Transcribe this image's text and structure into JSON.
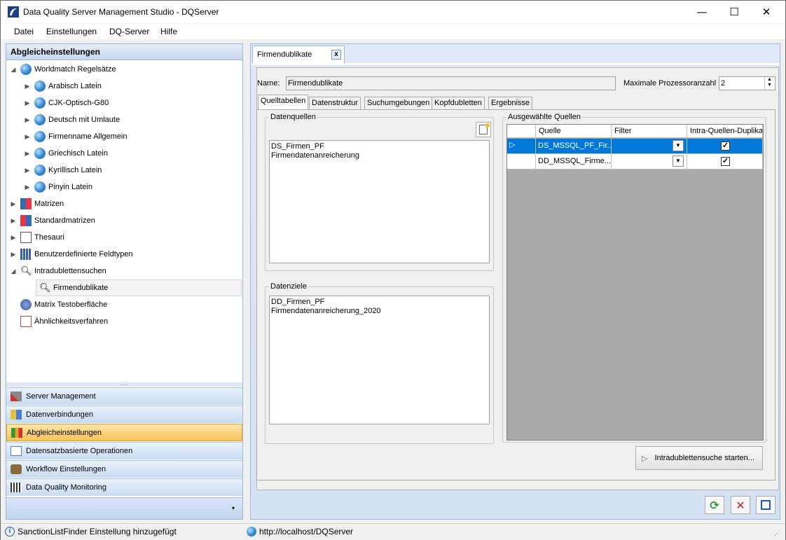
{
  "window": {
    "title": "Data Quality Server Management Studio - DQServer",
    "minimize": "—",
    "maximize": "☐",
    "close": "✕"
  },
  "menu": [
    "Datei",
    "Einstellungen",
    "DQ-Server",
    "Hilfe"
  ],
  "left_panel": {
    "header": "Abgleicheinstellungen",
    "tree": {
      "worldmatch": "Worldmatch Regelsätze",
      "children": [
        "Arabisch Latein",
        "CJK-Optisch-G80",
        "Deutsch mit Umlaute",
        "Firmenname Allgemein",
        "Griechisch Latein",
        "Kyrillisch Latein",
        "Pinyin Latein"
      ],
      "matrizen": "Matrizen",
      "standardmatrizen": "Standardmatrizen",
      "thesauri": "Thesauri",
      "feldtypen": "Benutzerdefinierte Feldtypen",
      "intradubletten": "Intradublettensuchen",
      "firmendublikate": "Firmendublikate",
      "matrix_test": "Matrix Testoberfläche",
      "aehnlichkeit": "Ähnlichkeitsverfahren"
    },
    "nav": [
      "Server Management",
      "Datenverbindungen",
      "Abgleicheinstellungen",
      "Datensatzbasierte Operationen",
      "Workflow Einstellungen",
      "Data Quality Monitoring"
    ]
  },
  "document": {
    "tab_label": "Firmendublikate",
    "tab_close": "x",
    "name_label": "Name:",
    "name_value": "Firmendublikate",
    "max_proc_label": "Maximale Prozessoranzahl",
    "max_proc_value": "2",
    "tabs": [
      "Quelltabellen",
      "Datenstruktur",
      "Suchumgebungen",
      "Kopfdubletten",
      "Ergebnisse"
    ],
    "datenquellen": {
      "title": "Datenquellen",
      "items": [
        "DS_Firmen_PF",
        "Firmendatenanreicherung"
      ]
    },
    "datenziele": {
      "title": "Datenziele",
      "items": [
        "DD_Firmen_PF",
        "Firmendatenanreicherung_2020"
      ]
    },
    "ausgewaehlte": {
      "title": "Ausgewählte Quellen",
      "columns": [
        "Quelle",
        "Filter",
        "Intra-Quellen-Duplikate"
      ],
      "rows": [
        {
          "quelle": "DS_MSSQL_PF_Fir...",
          "checked": true
        },
        {
          "quelle": "DD_MSSQL_Firme...",
          "checked": true
        }
      ]
    },
    "start_button": "Intradublettensuche starten..."
  },
  "status": {
    "message": "SanctionListFinder Einstellung hinzugefügt",
    "url": "http://localhost/DQServer"
  }
}
